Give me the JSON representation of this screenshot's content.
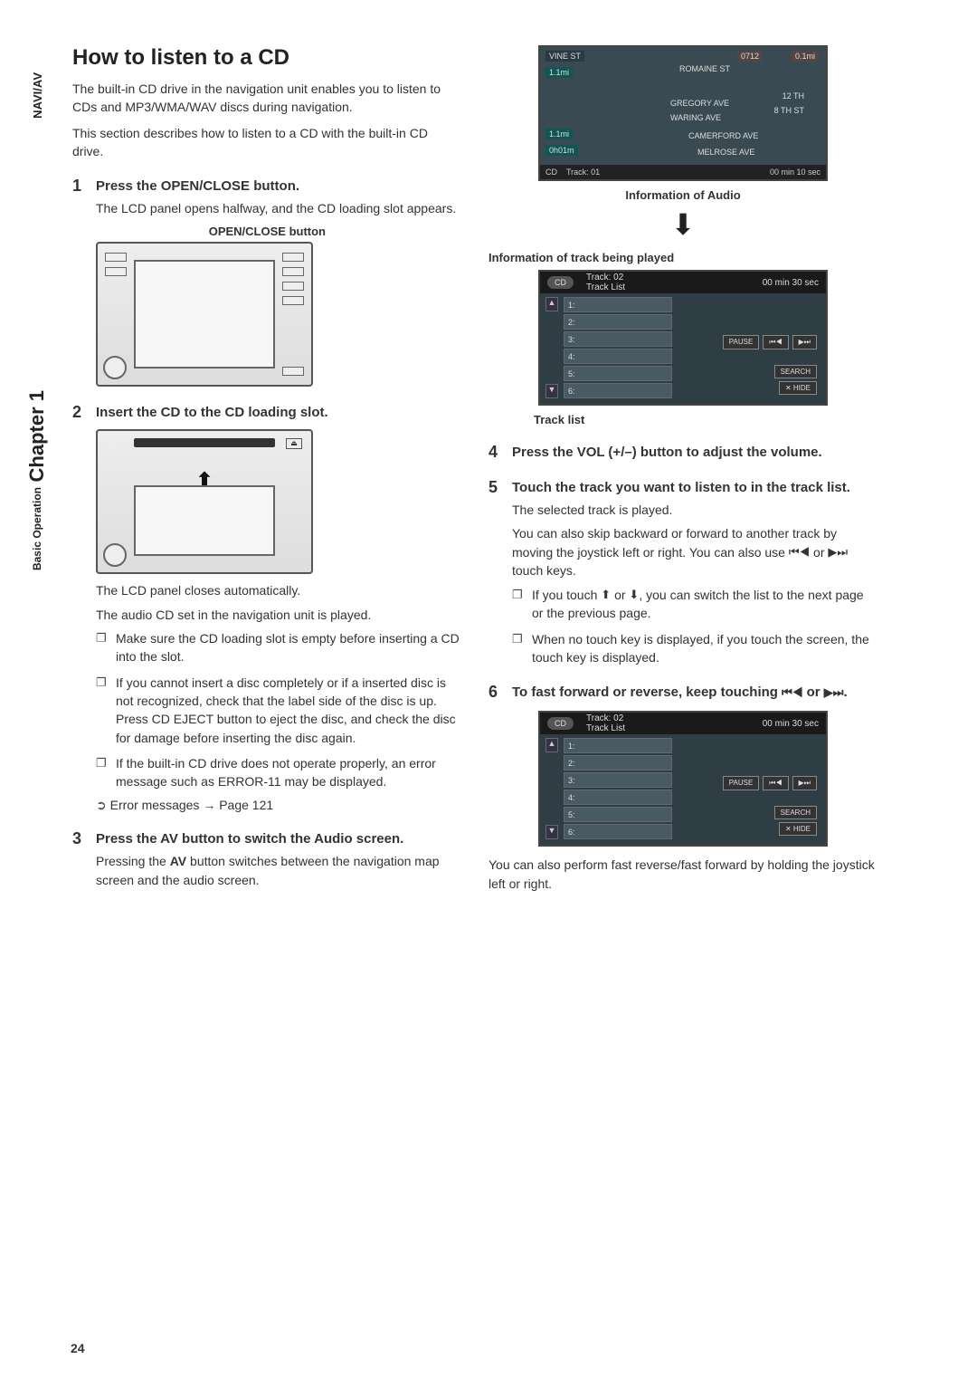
{
  "sidebar": {
    "naviav": "NAVI/AV",
    "basicop": "Basic Operation",
    "chapter": "Chapter 1"
  },
  "title": "How to listen to a CD",
  "intro": {
    "p1": "The built-in CD drive in the navigation unit enables you to listen to CDs and MP3/WMA/WAV discs during navigation.",
    "p2": "This section describes how to listen to a CD with the built-in CD drive."
  },
  "steps": {
    "s1": {
      "num": "1",
      "title": "Press the OPEN/CLOSE button.",
      "body": "The LCD panel opens halfway, and the CD loading slot appears.",
      "caption": "OPEN/CLOSE button"
    },
    "s2": {
      "num": "2",
      "title": "Insert the CD to the CD loading slot.",
      "body1": "The LCD panel closes automatically.",
      "body2": "The audio CD set in the navigation unit is played.",
      "bullets": [
        "Make sure the CD loading slot is empty before inserting a CD into the slot.",
        "If you cannot insert a disc completely or if a inserted disc is not recognized, check that the label side of the disc is up. Press CD EJECT button to eject the disc, and check the disc for damage before inserting the disc again.",
        "If the built-in CD drive does not operate properly, an error message such as ERROR-11 may be displayed."
      ],
      "xref_label": "Error messages",
      "xref_arrow": "→",
      "xref_page": "Page 121"
    },
    "s3": {
      "num": "3",
      "title": "Press the AV button to switch the Audio screen.",
      "body_a": "Pressing the ",
      "body_bold": "AV",
      "body_b": " button switches between the navigation map screen and the audio screen."
    },
    "s4": {
      "num": "4",
      "title": "Press the VOL (+/–) button to adjust the volume."
    },
    "s5": {
      "num": "5",
      "title": "Touch the track you want to listen to in the track list.",
      "body1": "The selected track is played.",
      "body2a": "You can also skip backward or forward to another track by moving the joystick left or right. You can also use ",
      "body2b": " or ",
      "body2c": " touch keys.",
      "bullets_a": "If you touch ",
      "bullets_b": " or ",
      "bullets_c": ", you can switch the list to the next page or the previous page.",
      "bullet2": "When no touch key is displayed, if you touch the screen, the touch key is displayed."
    },
    "s6": {
      "num": "6",
      "title_a": "To fast forward or reverse, keep touching ",
      "title_b": " or ",
      "title_c": ".",
      "footer": "You can also perform fast reverse/fast forward by holding the joystick left or right."
    }
  },
  "right_captions": {
    "c1": "Information of Audio",
    "c2": "Information of track being played",
    "c3": "Track list"
  },
  "nav_shot": {
    "vine": "VINE ST",
    "romaine": "ROMAINE ST",
    "gregory": "GREGORY AVE",
    "waring": "WARING AVE",
    "camerford": "CAMERFORD AVE",
    "melrose": "MELROSE AVE",
    "twelfth": "12 TH",
    "eighth": "8 TH ST",
    "dist1": "1.1mi",
    "dist2": "1.1mi",
    "time_left": "0h01m",
    "time_top": "0712",
    "scale": "0.1mi",
    "bottom_cd": "CD",
    "bottom_track": "Track: 01",
    "bottom_time": "00 min   10 sec"
  },
  "track_shot": {
    "cd": "CD",
    "header_track": "Track: 02",
    "header_list": "Track List",
    "header_time": "00 min   30 sec",
    "rows": [
      "1:",
      "2:",
      "3:",
      "4:",
      "5:",
      "6:"
    ],
    "pause": "PAUSE",
    "prev": "⏮◀",
    "next": "▶⏭",
    "search": "SEARCH",
    "hide": "✕ HIDE"
  },
  "icons": {
    "prev": "⏮◀",
    "next": "▶⏭",
    "up_combo": "⬆",
    "down_combo": "⬇"
  },
  "page_number": "24"
}
